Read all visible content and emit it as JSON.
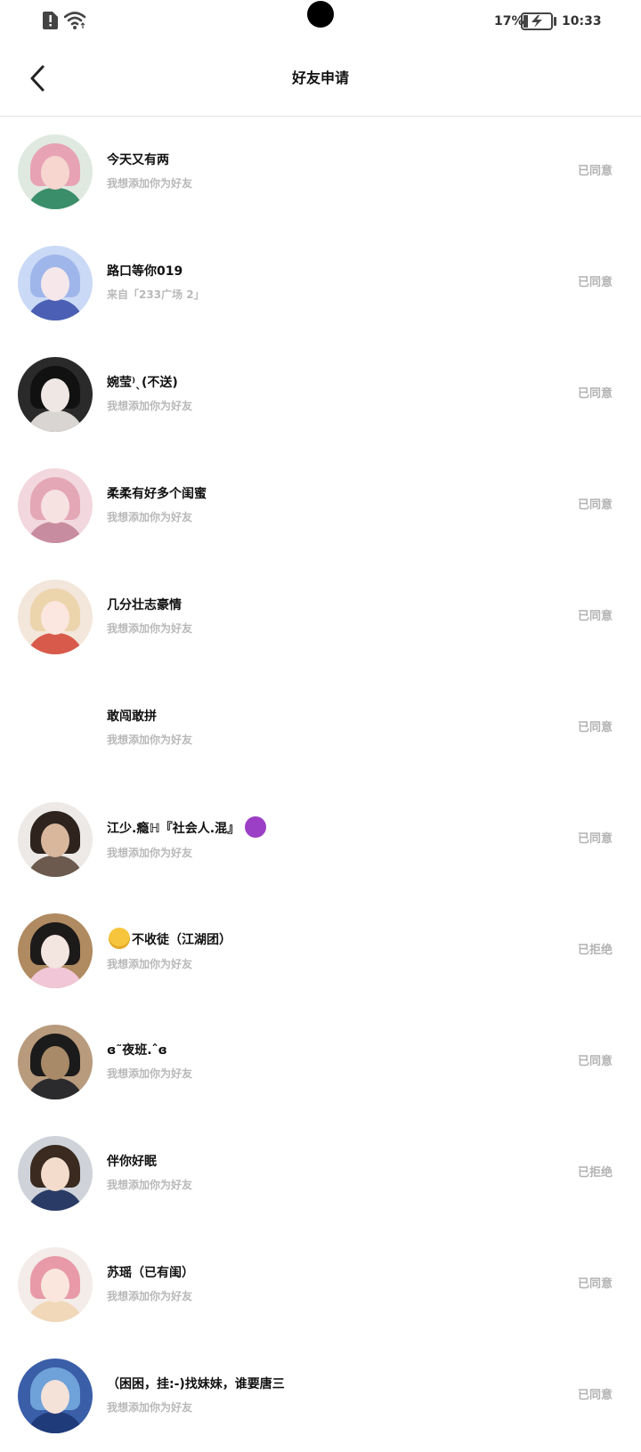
{
  "status_bar": {
    "battery_percent": "17%",
    "time": "10:33"
  },
  "header": {
    "title": "好友申请"
  },
  "requests": [
    {
      "name": "今天又有两",
      "sub": "我想添加你为好友",
      "status": "已同意",
      "avatar": {
        "bg": "#dfe9e0",
        "hair": "#e7a3b4",
        "face": "#f6d6cf",
        "body": "#3b8e6a"
      }
    },
    {
      "name": "路口等你019",
      "sub": "来自「233广场 2」",
      "status": "已同意",
      "avatar": {
        "bg": "#cad9f5",
        "hair": "#9fb6ea",
        "face": "#f5e7ea",
        "body": "#4b5fb4"
      }
    },
    {
      "name": "婉莹⁾ˎ(不送)",
      "sub": "我想添加你为好友",
      "status": "已同意",
      "avatar": {
        "bg": "#2a2a2a",
        "hair": "#111111",
        "face": "#efe7e3",
        "body": "#d9d5d2"
      }
    },
    {
      "name": "柔柔有好多个闺蜜",
      "sub": "我想添加你为好友",
      "status": "已同意",
      "avatar": {
        "bg": "#f2d7de",
        "hair": "#e4a7b6",
        "face": "#f7e2e2",
        "body": "#c88ca0"
      }
    },
    {
      "name": "几分壮志豪情",
      "sub": "我想添加你为好友",
      "status": "已同意",
      "avatar": {
        "bg": "#f3e6da",
        "hair": "#ecd4ad",
        "face": "#fbe7df",
        "body": "#d85a4b"
      }
    },
    {
      "name": "敢闯敢拼",
      "sub": "我想添加你为好友",
      "status": "已同意",
      "avatar": null
    },
    {
      "name": "江少.瘾ℍ『社会人.混』",
      "name_emoji": "devil",
      "sub": "我想添加你为好友",
      "status": "已同意",
      "avatar": {
        "bg": "#ece9e6",
        "hair": "#2e241d",
        "face": "#d8b79d",
        "body": "#6b5a4d"
      }
    },
    {
      "name": "不收徒（江湖团）",
      "name_emoji_before": "smile",
      "sub": "我想添加你为好友",
      "status": "已拒绝",
      "avatar": {
        "bg": "#b08a60",
        "hair": "#1d1a1a",
        "face": "#f3e5df",
        "body": "#f1c6d6"
      }
    },
    {
      "name": "ɞ˜夜班.ˆɞ",
      "sub": "我想添加你为好友",
      "status": "已同意",
      "avatar": {
        "bg": "#b89a7c",
        "hair": "#1c1b1b",
        "face": "#a88a68",
        "body": "#2b2b2e"
      }
    },
    {
      "name": "伴你好眠",
      "sub": "我想添加你为好友",
      "status": "已拒绝",
      "avatar": {
        "bg": "#cfd3d9",
        "hair": "#3a2a20",
        "face": "#f3dccb",
        "body": "#2a3b66"
      }
    },
    {
      "name": "苏瑶（已有闺）",
      "sub": "我想添加你为好友",
      "status": "已同意",
      "avatar": {
        "bg": "#f3ece9",
        "hair": "#e89aa8",
        "face": "#fae6dc",
        "body": "#f0d8b8"
      }
    },
    {
      "name": "（困困，挂:-)找妹妹，谁要唐三",
      "sub": "我想添加你为好友",
      "status": "已同意",
      "avatar": {
        "bg": "#3a5ea8",
        "hair": "#6fa2d8",
        "face": "#f4e2d8",
        "body": "#1f3b79"
      }
    }
  ]
}
